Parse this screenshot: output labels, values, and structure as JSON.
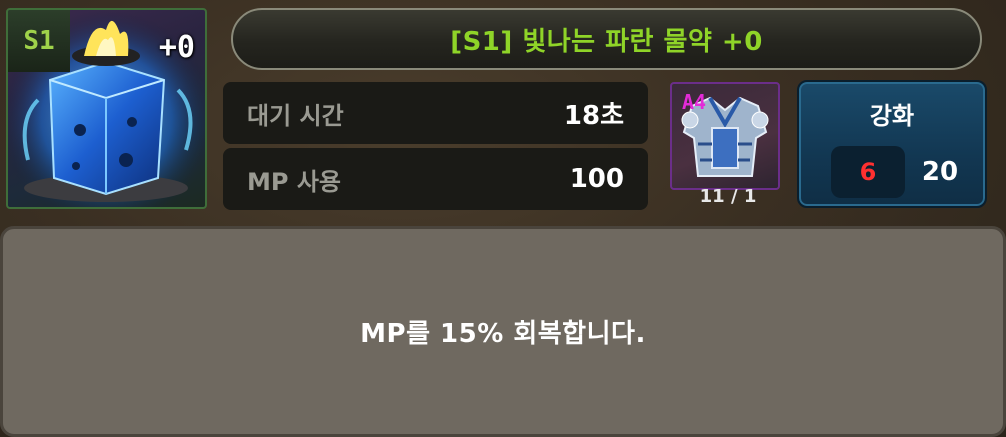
{
  "item": {
    "grade": "S1",
    "enhance_badge": "+0",
    "icon": "blue-flame-cube-icon"
  },
  "title": "[S1] 빛나는 파란 물약 +0",
  "stats": [
    {
      "label": "대기 시간",
      "value": "18초"
    },
    {
      "label": "MP 사용",
      "value": "100"
    }
  ],
  "equip": {
    "grade": "A4",
    "icon": "armor-icon",
    "count": "11 / 1"
  },
  "enhance": {
    "label": "강화",
    "current": "6",
    "max": "20"
  },
  "description": "MP를 15% 회복합니다.",
  "colors": {
    "title": "#8fd428",
    "grade_s": "#9fd24a",
    "grade_a": "#e32bd8",
    "enhance_current": "#ff3030",
    "enhance_btn": "#123752"
  }
}
